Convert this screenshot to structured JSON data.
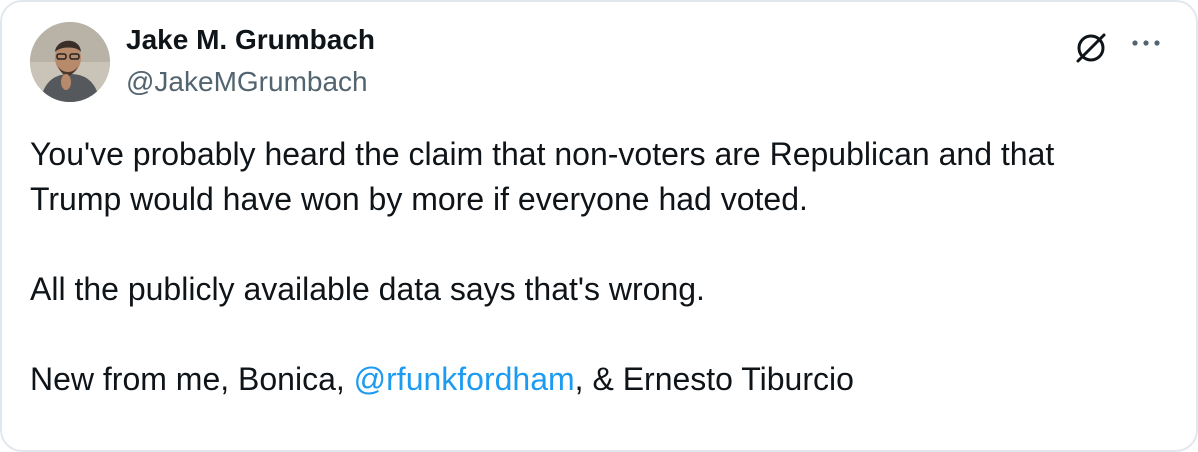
{
  "tweet": {
    "author_name": "Jake M. Grumbach",
    "author_handle": "@JakeMGrumbach",
    "paragraph1_line1": "You've probably heard the claim that non-voters are Republican and that",
    "paragraph1_line2": "Trump would have won by more if everyone had voted.",
    "paragraph2": "All the publicly available data says that's wrong.",
    "paragraph3_prefix": "New from me, Bonica, ",
    "paragraph3_mention": "@rfunkfordham",
    "paragraph3_suffix": ", & Ernesto Tiburcio"
  },
  "icons": {
    "avatar": "profile-photo",
    "x": "x-logo-icon",
    "more": "more-options-icon"
  },
  "colors": {
    "link": "#1d9bf0",
    "text": "#0f1419",
    "secondary": "#536471",
    "border": "#e1e8ed"
  }
}
